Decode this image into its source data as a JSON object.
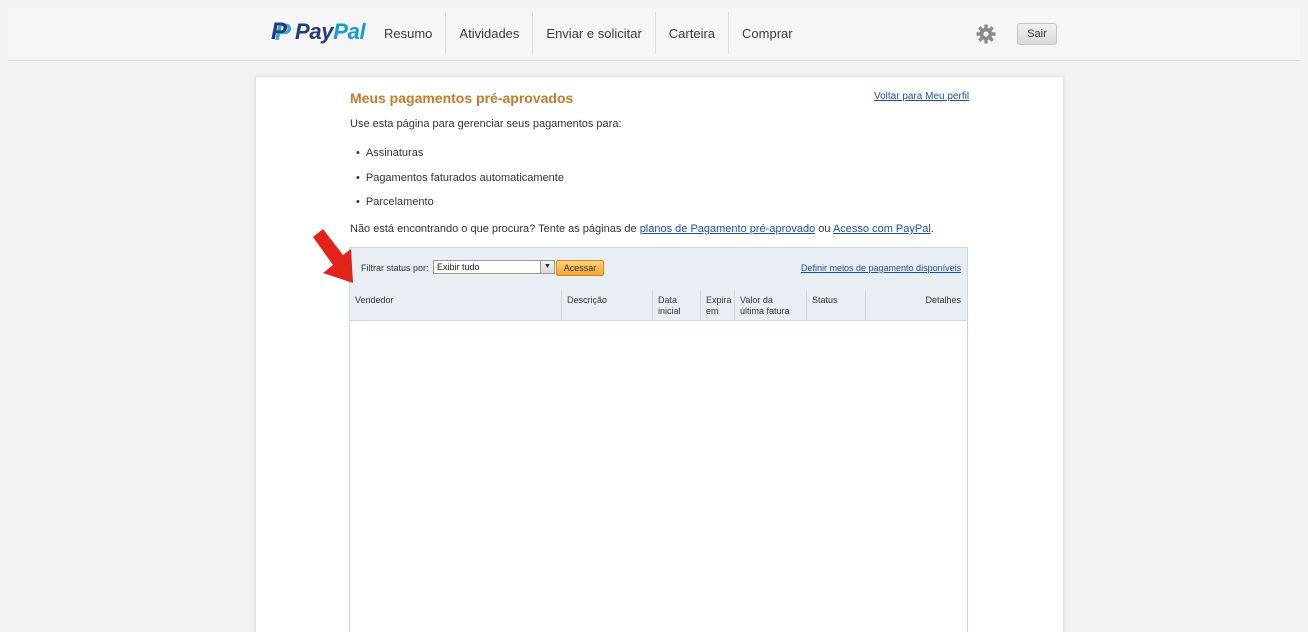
{
  "header": {
    "logo": {
      "pay": "Pay",
      "pal": "Pal"
    },
    "nav": [
      {
        "label": "Resumo"
      },
      {
        "label": "Atividades"
      },
      {
        "label": "Enviar e solicitar"
      },
      {
        "label": "Carteira"
      },
      {
        "label": "Comprar"
      }
    ],
    "settings_icon": "gear-icon",
    "logout_label": "Sair"
  },
  "main": {
    "title": "Meus pagamentos pré-aprovados",
    "back_link": "Voltar para Meu perfil",
    "intro": "Use esta página para gerenciar seus pagamentos para:",
    "bullets": [
      "Assinaturas",
      "Pagamentos faturados automaticamente",
      "Parcelamento"
    ],
    "help": {
      "prefix": "Não está encontrando o que procura? Tente as páginas de ",
      "link1": "planos de Pagamento pré-aprovado",
      "middle": " ou ",
      "link2": "Acesso com PayPal",
      "suffix": "."
    }
  },
  "filter": {
    "label": "Filtrar status por:",
    "selected": "Exibir tudo",
    "button": "Acessar",
    "define_link": "Definir meios de pagamento disponíveis"
  },
  "table": {
    "columns": [
      "Vendedor",
      "Descrição",
      "Data\ninicial",
      "Expira\nem",
      "Valor da\núltima fatura",
      "Status",
      "Detalhes"
    ],
    "rows": []
  },
  "colors": {
    "title": "#c37a2d",
    "link": "#1f4ea7",
    "annotation_arrow": "#e2231a",
    "paypal_dark": "#253b80",
    "paypal_light": "#179bd7"
  }
}
